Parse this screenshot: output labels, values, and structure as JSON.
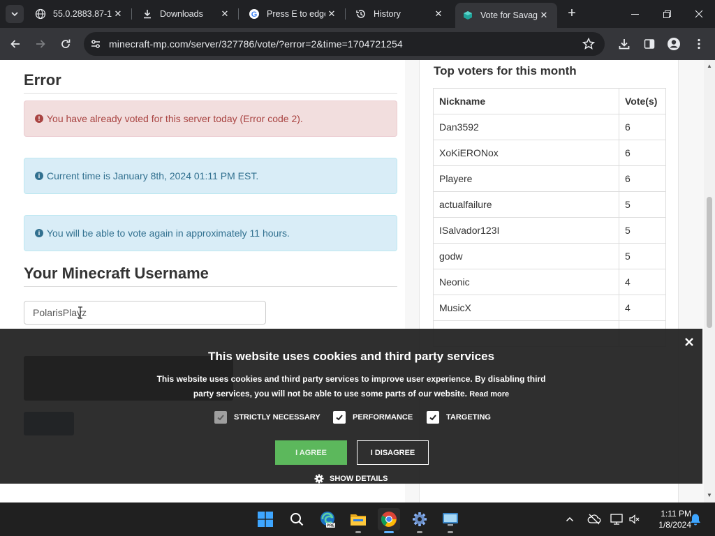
{
  "browser": {
    "tabs": [
      {
        "title": "55.0.2883.87-1",
        "favicon": "globe-icon"
      },
      {
        "title": "Downloads",
        "favicon": "download-icon"
      },
      {
        "title": "Press E to edge",
        "favicon": "google-icon"
      },
      {
        "title": "History",
        "favicon": "history-icon"
      },
      {
        "title": "Vote for Savage",
        "favicon": "cube-icon",
        "active": true
      }
    ],
    "url": "minecraft-mp.com/server/327786/vote/?error=2&time=1704721254"
  },
  "page": {
    "error_title": "Error",
    "alerts": {
      "danger": "You have already voted for this server today (Error code 2).",
      "time": "Current time is January 8th, 2024 01:11 PM EST.",
      "next_vote": "You will be able to vote again in approximately 11 hours."
    },
    "username_title": "Your Minecraft Username",
    "username_value": "PolarisPlayz"
  },
  "top_voters": {
    "title": "Top voters for this month",
    "columns": [
      "Nickname",
      "Vote(s)"
    ],
    "rows": [
      {
        "nickname": "Dan3592",
        "votes": "6"
      },
      {
        "nickname": "XoKiERONox",
        "votes": "6"
      },
      {
        "nickname": "Playere",
        "votes": "6"
      },
      {
        "nickname": "actualfailure",
        "votes": "5"
      },
      {
        "nickname": "ISalvador123I",
        "votes": "5"
      },
      {
        "nickname": "godw",
        "votes": "5"
      },
      {
        "nickname": "Neonic",
        "votes": "4"
      },
      {
        "nickname": "MusicX",
        "votes": "4"
      }
    ]
  },
  "cookie": {
    "title": "This website uses cookies and third party services",
    "description": "This website uses cookies and third party services to improve user experience. By disabling third party services, you will not be able to use some parts of our website.",
    "read_more": "Read more",
    "options": [
      {
        "label": "STRICTLY NECESSARY",
        "checked": true,
        "disabled": true
      },
      {
        "label": "PERFORMANCE",
        "checked": true
      },
      {
        "label": "TARGETING",
        "checked": true
      }
    ],
    "agree": "I AGREE",
    "disagree": "I DISAGREE",
    "show_details": "SHOW DETAILS"
  },
  "taskbar": {
    "time": "1:11 PM",
    "date": "1/8/2024"
  }
}
